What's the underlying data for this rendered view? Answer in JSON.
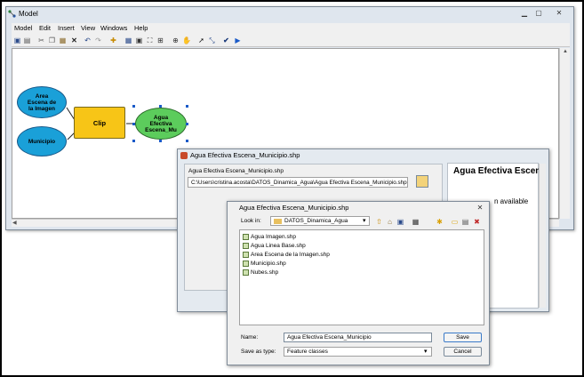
{
  "model_window": {
    "title": "Model",
    "menu": [
      "Model",
      "Edit",
      "Insert",
      "View",
      "Windows",
      "Help"
    ],
    "nodes": {
      "area": "Area Escena de la Imagen",
      "municipio": "Municipio",
      "clip": "Clip",
      "output": "Agua Efectiva Escena_Mu"
    }
  },
  "tool_dialog": {
    "title": "Agua Efectiva Escena_Municipio.shp",
    "param_label": "Agua Efectiva Escena_Municipio.shp",
    "param_value": "C:\\Users\\cristina.acosta\\DATOS_Dinamica_Agua\\Agua Efectiva Escena_Municipio.shp",
    "help_title": "Agua Efectiva Escena_Municipio.shp",
    "help_text": "n available"
  },
  "save_dialog": {
    "title": "Agua Efectiva Escena_Municipio.shp",
    "look_in_label": "Look in:",
    "look_in_value": "DATOS_Dinamica_Agua",
    "files": [
      "Agua Imagen.shp",
      "Agua Linea Base.shp",
      "Area Escena de la Imagen.shp",
      "Municipio.shp",
      "Nubes.shp"
    ],
    "name_label": "Name:",
    "name_value": "Agua Efectiva Escena_Municipio",
    "type_label": "Save as type:",
    "type_value": "Feature classes",
    "save_button": "Save",
    "cancel_button": "Cancel"
  }
}
